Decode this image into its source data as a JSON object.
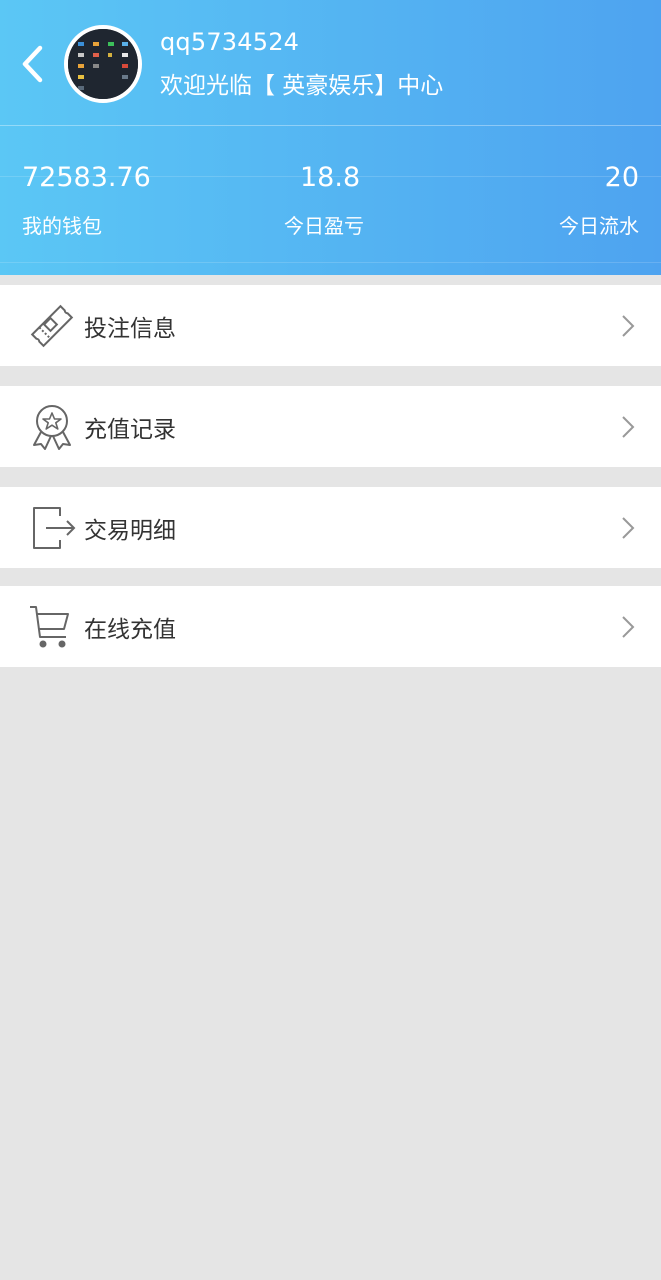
{
  "header": {
    "username": "qq5734524",
    "welcome": "欢迎光临【 英豪娱乐】中心",
    "colors": {
      "gradient_start": "#5bc7f5",
      "gradient_end": "#4ea3f0"
    }
  },
  "stats": [
    {
      "value": "72583.76",
      "label": "我的钱包"
    },
    {
      "value": "18.8",
      "label": "今日盈亏"
    },
    {
      "value": "20",
      "label": "今日流水"
    }
  ],
  "menu": [
    {
      "label": "投注信息",
      "icon": "ticket-icon"
    },
    {
      "label": "充值记录",
      "icon": "award-badge-icon"
    },
    {
      "label": "交易明细",
      "icon": "exit-arrow-icon"
    },
    {
      "label": "在线充值",
      "icon": "shopping-cart-icon"
    }
  ]
}
